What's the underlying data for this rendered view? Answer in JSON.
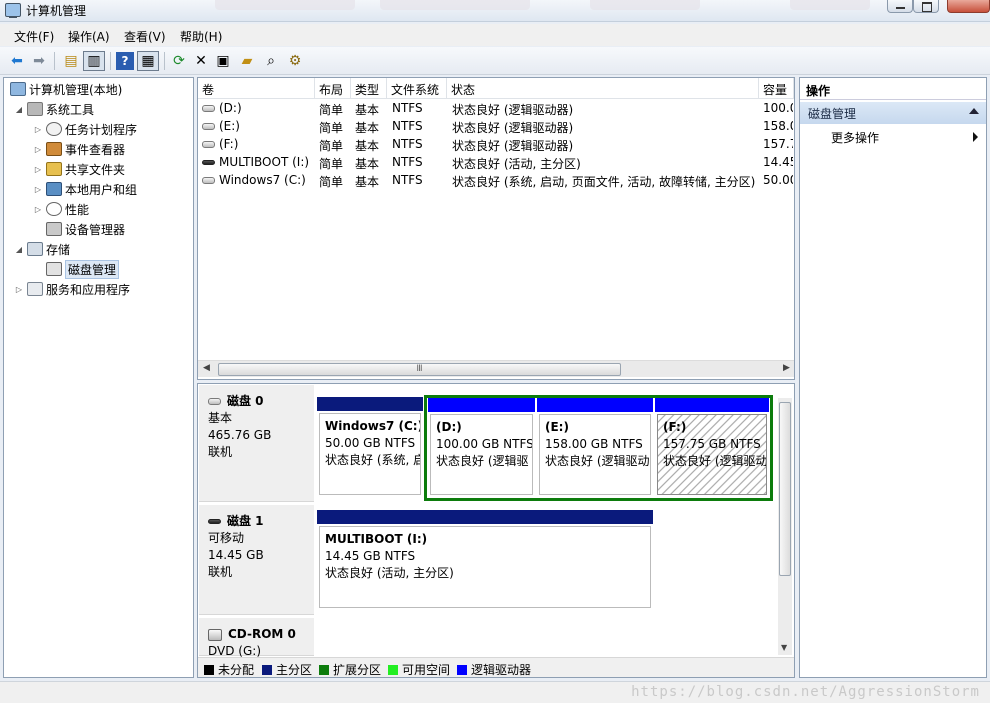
{
  "window": {
    "title": "计算机管理"
  },
  "menu": [
    "文件(F)",
    "操作(A)",
    "查看(V)",
    "帮助(H)"
  ],
  "toolbar": {
    "icons": [
      "back-arrow-icon",
      "forward-arrow-icon",
      "up-folder-icon",
      "show-tree-icon",
      "help-icon",
      "show-action-pane-icon",
      "refresh-icon",
      "delete-icon",
      "properties-icon",
      "open-icon",
      "search-icon",
      "settings-icon"
    ]
  },
  "tree": [
    {
      "label": "计算机管理(本地)",
      "level": 0,
      "twisty": "",
      "icon": "computer-icon"
    },
    {
      "label": "系统工具",
      "level": 1,
      "twisty": "◢",
      "icon": "tools-icon"
    },
    {
      "label": "任务计划程序",
      "level": 2,
      "twisty": "▷",
      "icon": "clock-icon"
    },
    {
      "label": "事件查看器",
      "level": 2,
      "twisty": "▷",
      "icon": "event-viewer-icon"
    },
    {
      "label": "共享文件夹",
      "level": 2,
      "twisty": "▷",
      "icon": "shared-folder-icon"
    },
    {
      "label": "本地用户和组",
      "level": 2,
      "twisty": "▷",
      "icon": "users-icon"
    },
    {
      "label": "性能",
      "level": 2,
      "twisty": "▷",
      "icon": "performance-icon"
    },
    {
      "label": "设备管理器",
      "level": 2,
      "twisty": "",
      "icon": "device-manager-icon"
    },
    {
      "label": "存储",
      "level": 1,
      "twisty": "◢",
      "icon": "storage-icon"
    },
    {
      "label": "磁盘管理",
      "level": 2,
      "twisty": "",
      "icon": "disk-management-icon",
      "selected": true
    },
    {
      "label": "服务和应用程序",
      "level": 1,
      "twisty": "▷",
      "icon": "services-icon"
    }
  ],
  "volume_list": {
    "columns": [
      "卷",
      "布局",
      "类型",
      "文件系统",
      "状态",
      "容量"
    ],
    "rows": [
      {
        "volume": "(D:)",
        "layout": "简单",
        "type": "基本",
        "fs": "NTFS",
        "status": "状态良好 (逻辑驱动器)",
        "capacity": "100.0",
        "icon": "drive-icon"
      },
      {
        "volume": "(E:)",
        "layout": "简单",
        "type": "基本",
        "fs": "NTFS",
        "status": "状态良好 (逻辑驱动器)",
        "capacity": "158.0",
        "icon": "drive-icon"
      },
      {
        "volume": "(F:)",
        "layout": "简单",
        "type": "基本",
        "fs": "NTFS",
        "status": "状态良好 (逻辑驱动器)",
        "capacity": "157.7",
        "icon": "drive-icon"
      },
      {
        "volume": "MULTIBOOT (I:)",
        "layout": "简单",
        "type": "基本",
        "fs": "NTFS",
        "status": "状态良好 (活动, 主分区)",
        "capacity": "14.45",
        "icon": "removable-drive-icon"
      },
      {
        "volume": "Windows7 (C:)",
        "layout": "简单",
        "type": "基本",
        "fs": "NTFS",
        "status": "状态良好 (系统, 启动, 页面文件, 活动, 故障转储, 主分区)",
        "capacity": "50.00",
        "icon": "drive-icon"
      }
    ],
    "scroll_thumb": "Ⅲ"
  },
  "disks": [
    {
      "name": "磁盘 0",
      "kind": "基本",
      "size": "465.76 GB",
      "state": "联机",
      "partitions": [
        {
          "name": "Windows7  (C:)",
          "size": "50.00 GB NTFS",
          "status": "状态良好 (系统, 启",
          "bar": "#0a1a7c"
        },
        {
          "name": "(D:)",
          "size": "100.00 GB NTFS",
          "status": "状态良好 (逻辑驱",
          "bar": "#0000ff"
        },
        {
          "name": "(E:)",
          "size": "158.00 GB NTFS",
          "status": "状态良好 (逻辑驱动",
          "bar": "#0000ff"
        },
        {
          "name": "(F:)",
          "size": "157.75 GB NTFS",
          "status": "状态良好 (逻辑驱动",
          "bar": "#0000ff"
        }
      ]
    },
    {
      "name": "磁盘 1",
      "kind": "可移动",
      "size": "14.45 GB",
      "state": "联机",
      "partitions": [
        {
          "name": "MULTIBOOT  (I:)",
          "size": "14.45 GB NTFS",
          "status": "状态良好 (活动, 主分区)",
          "bar": "#0a1a7c"
        }
      ]
    },
    {
      "name": "CD-ROM 0",
      "kind": "DVD (G:)"
    }
  ],
  "legend": [
    {
      "label": "未分配",
      "color": "#000000"
    },
    {
      "label": "主分区",
      "color": "#0a1a7c"
    },
    {
      "label": "扩展分区",
      "color": "#0c7c0c"
    },
    {
      "label": "可用空间",
      "color": "#22ee22"
    },
    {
      "label": "逻辑驱动器",
      "color": "#0000ff"
    }
  ],
  "actions": {
    "header": "操作",
    "section": "磁盘管理",
    "more": "更多操作"
  },
  "watermark": "https://blog.csdn.net/AggressionStorm"
}
